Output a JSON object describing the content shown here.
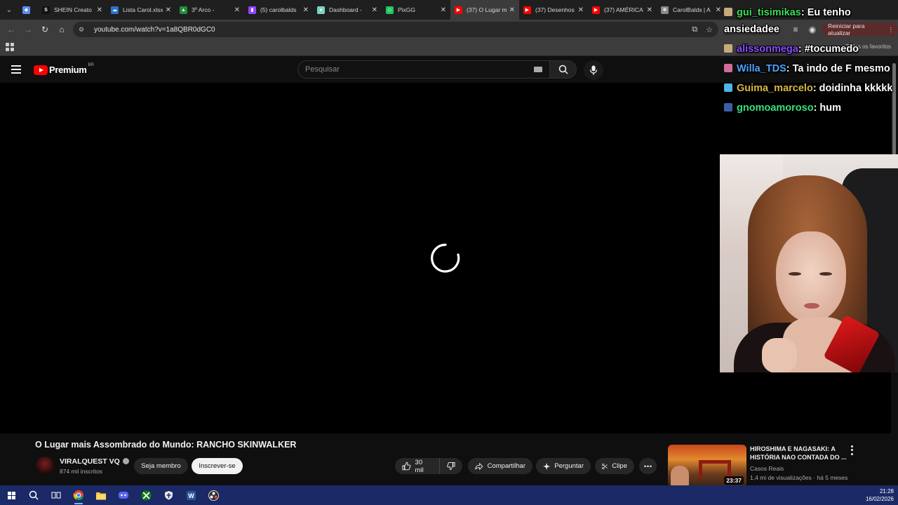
{
  "browser": {
    "tabs": [
      {
        "title": "",
        "favicon_color": "#5b8def",
        "glyph": "◆",
        "small": true
      },
      {
        "title": "SHEIN Creato",
        "favicon_color": "#111111",
        "glyph": "S"
      },
      {
        "title": "Lista Carol.xlsx",
        "favicon_color": "#2f73c9",
        "glyph": "☁"
      },
      {
        "title": "3º Arco -",
        "favicon_color": "#1e8e3e",
        "glyph": "▲"
      },
      {
        "title": "(5) carolbalds",
        "favicon_color": "#9146ff",
        "glyph": "▮"
      },
      {
        "title": "Dashboard -",
        "favicon_color": "#7ad3c4",
        "glyph": "●"
      },
      {
        "title": "PixGG",
        "favicon_color": "#22c55e",
        "glyph": "◇"
      },
      {
        "title": "(37) O Lugar m",
        "favicon_color": "#ff0000",
        "glyph": "▶",
        "active": true
      },
      {
        "title": "(37) Desenhos",
        "favicon_color": "#ff0000",
        "glyph": "▶"
      },
      {
        "title": "(37) AMÉRICA",
        "favicon_color": "#ff0000",
        "glyph": "▶"
      },
      {
        "title": "CarolBalds | A",
        "favicon_color": "#888888",
        "glyph": "⊕"
      }
    ],
    "url": "youtube.com/watch?v=1a8QBR0dGC0",
    "restart_label": "Reiniciar para atualizar",
    "bookmarks_right": "Todos os favoritos"
  },
  "youtube": {
    "logo_text": "Premium",
    "logo_region": "BR",
    "search_placeholder": "Pesquisar"
  },
  "video": {
    "title": "O Lugar mais Assombrado do Mundo: RANCHO SKINWALKER",
    "channel_name": "VIRALQUEST VQ",
    "subscribers": "874 mil inscritos",
    "member_label": "Seja membro",
    "subscribe_label": "Inscrever-se",
    "likes": "30 mil",
    "share_label": "Compartilhar",
    "ask_label": "Perguntar",
    "clip_label": "Clipe"
  },
  "recommended": {
    "title": "HIROSHIMA E NAGASAKI: A HISTÓRIA NAO CONTADA DO ...",
    "channel": "Casos Reais",
    "meta": "1,4 mi de visualizações · há 5 meses",
    "duration": "23:37"
  },
  "chat": [
    {
      "user": "gui_tisimikas",
      "user_color": "#3ddc5b",
      "text": ": Eu tenho ansiedadee",
      "badge_color": "#c7a97b"
    },
    {
      "user": "alissonmega",
      "user_color": "#8a4dff",
      "text": ": #tocumedo",
      "badge_color": "#c7a97b"
    },
    {
      "user": "Willa_TDS",
      "user_color": "#4ba3ff",
      "text": ": Ta indo de F mesmo",
      "badge_color": "#d06b9a"
    },
    {
      "user": "Guima_marcelo",
      "user_color": "#d8b643",
      "text": ": doidinha kkkkk",
      "badge_color": "#4fb4e6"
    },
    {
      "user": "gnomoamoroso",
      "user_color": "#36e07a",
      "text": ": hum",
      "badge_color": "#3a5fa8"
    }
  ],
  "taskbar": {
    "time": "21:28",
    "date": "16/02/2026"
  }
}
